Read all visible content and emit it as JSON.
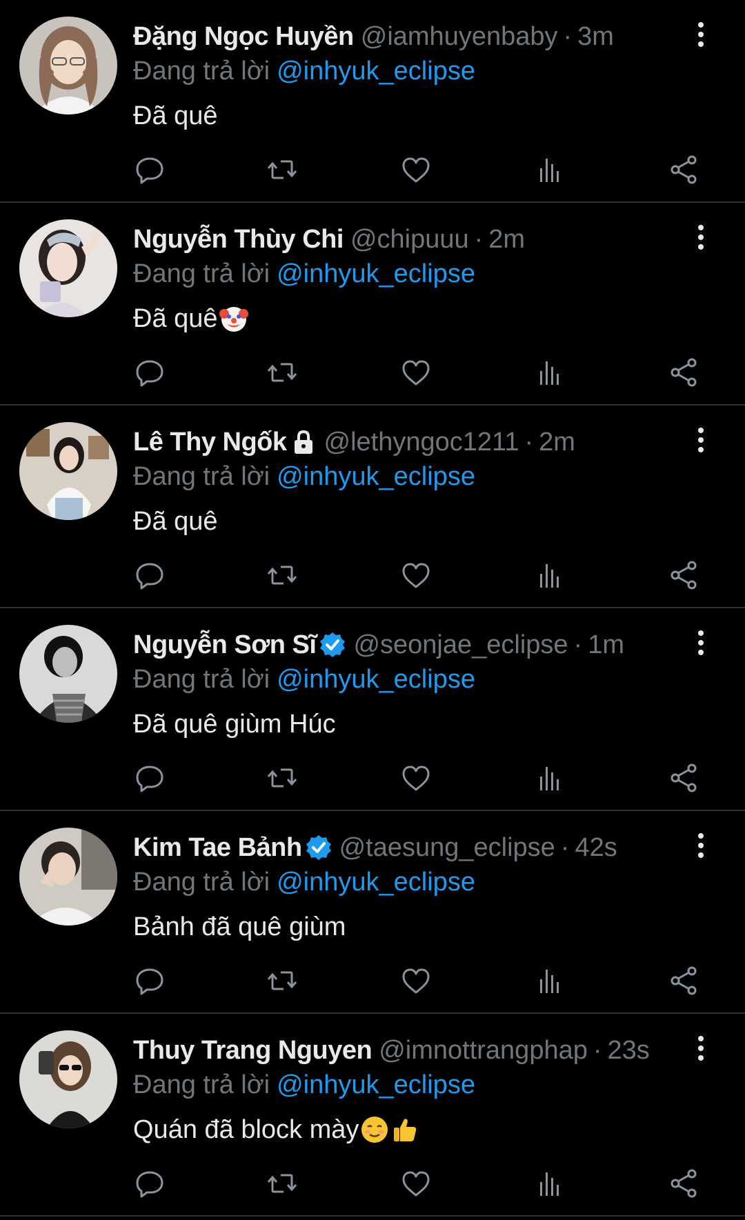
{
  "colors": {
    "background": "#000000",
    "text": "#e7e9ea",
    "muted": "#71767b",
    "link": "#1d9bf0",
    "divider": "#2f3336"
  },
  "icons": {
    "reply": "comment-icon",
    "retweet": "retweet-icon",
    "like": "heart-icon",
    "views": "bar-chart-icon",
    "share": "share-icon",
    "more": "more-vertical-icon"
  },
  "tweets": [
    {
      "name": "Đặng Ngọc Huyền",
      "handle": "@iamhuyenbaby",
      "separator": "·",
      "time": "3m",
      "reply_prefix": "Đang trả lời",
      "reply_to": "@inhyuk_eclipse",
      "text": "Đã quê",
      "badge": "",
      "emoji": ""
    },
    {
      "name": "Nguyễn Thùy Chi",
      "handle": "@chipuuu",
      "separator": "·",
      "time": "2m",
      "reply_prefix": "Đang trả lời",
      "reply_to": "@inhyuk_eclipse",
      "text": "Đã quê",
      "badge": "",
      "emoji": "clown"
    },
    {
      "name": "Lê Thy Ngốk",
      "handle": "@lethyngoc1211",
      "separator": "·",
      "time": "2m",
      "reply_prefix": "Đang trả lời",
      "reply_to": "@inhyuk_eclipse",
      "text": "Đã quê",
      "badge": "lock",
      "emoji": ""
    },
    {
      "name": "Nguyễn Sơn Sĩ",
      "handle": "@seonjae_eclipse",
      "separator": "·",
      "time": "1m",
      "reply_prefix": "Đang trả lời",
      "reply_to": "@inhyuk_eclipse",
      "text": "Đã quê giùm Húc",
      "badge": "verified",
      "emoji": ""
    },
    {
      "name": "Kim Tae Bảnh",
      "handle": "@taesung_eclipse",
      "separator": "·",
      "time": "42s",
      "reply_prefix": "Đang trả lời",
      "reply_to": "@inhyuk_eclipse",
      "text": "Bảnh đã quê giùm",
      "badge": "verified",
      "emoji": ""
    },
    {
      "name": "Thuy Trang Nguyen",
      "handle": "@imnottrangphap",
      "separator": "·",
      "time": "23s",
      "reply_prefix": "Đang trả lời",
      "reply_to": "@inhyuk_eclipse",
      "text": "Quán đã block mày",
      "badge": "",
      "emoji": "smile-thumbsup"
    }
  ]
}
